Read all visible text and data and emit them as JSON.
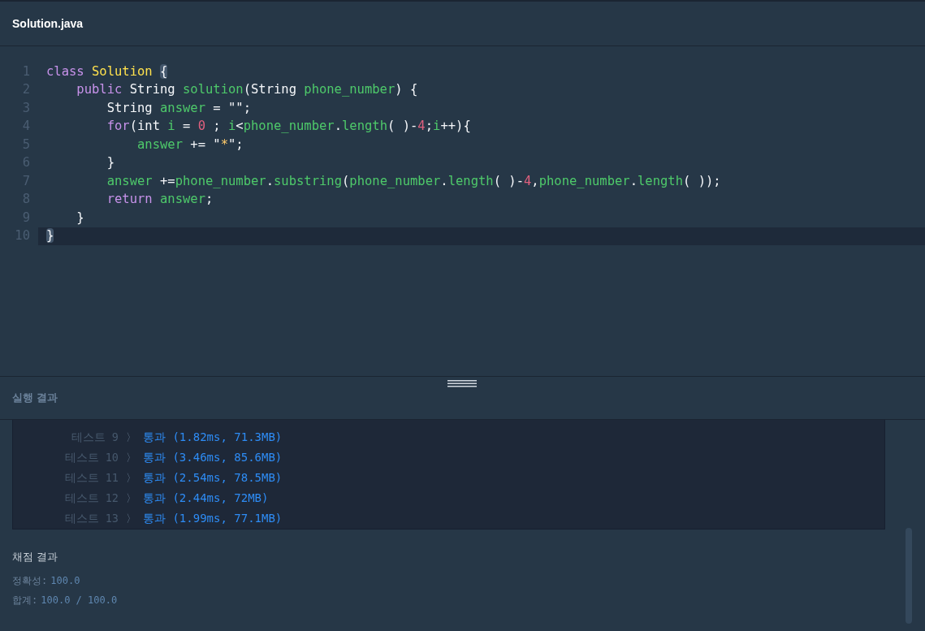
{
  "editor": {
    "file_name": "Solution.java",
    "lines": [
      {
        "number": "1",
        "current": false,
        "tokens": [
          {
            "text": "class ",
            "kind": "keyword"
          },
          {
            "text": "Solution ",
            "kind": "class"
          },
          {
            "text": "{",
            "kind": "bracket-match"
          }
        ]
      },
      {
        "number": "2",
        "current": false,
        "tokens": [
          {
            "text": "    public ",
            "kind": "keyword"
          },
          {
            "text": "String ",
            "kind": "plain"
          },
          {
            "text": "solution",
            "kind": "name"
          },
          {
            "text": "(String ",
            "kind": "plain"
          },
          {
            "text": "phone_number",
            "kind": "name"
          },
          {
            "text": ") {",
            "kind": "plain"
          }
        ]
      },
      {
        "number": "3",
        "current": false,
        "tokens": [
          {
            "text": "        String ",
            "kind": "plain"
          },
          {
            "text": "answer",
            "kind": "name"
          },
          {
            "text": " = \"\";",
            "kind": "plain"
          }
        ]
      },
      {
        "number": "4",
        "current": false,
        "tokens": [
          {
            "text": "        for",
            "kind": "keyword"
          },
          {
            "text": "(int ",
            "kind": "plain"
          },
          {
            "text": "i",
            "kind": "name"
          },
          {
            "text": " = ",
            "kind": "plain"
          },
          {
            "text": "0",
            "kind": "number"
          },
          {
            "text": " ; ",
            "kind": "plain"
          },
          {
            "text": "i",
            "kind": "name"
          },
          {
            "text": "<",
            "kind": "plain"
          },
          {
            "text": "phone_number",
            "kind": "name"
          },
          {
            "text": ".",
            "kind": "plain"
          },
          {
            "text": "length",
            "kind": "name"
          },
          {
            "text": "( )-",
            "kind": "plain"
          },
          {
            "text": "4",
            "kind": "number"
          },
          {
            "text": ";",
            "kind": "plain"
          },
          {
            "text": "i",
            "kind": "name"
          },
          {
            "text": "++){",
            "kind": "plain"
          }
        ]
      },
      {
        "number": "5",
        "current": false,
        "tokens": [
          {
            "text": "            answer",
            "kind": "name"
          },
          {
            "text": " += \"",
            "kind": "plain"
          },
          {
            "text": "*",
            "kind": "string"
          },
          {
            "text": "\";",
            "kind": "plain"
          }
        ]
      },
      {
        "number": "6",
        "current": false,
        "tokens": [
          {
            "text": "        }",
            "kind": "plain"
          }
        ]
      },
      {
        "number": "7",
        "current": false,
        "tokens": [
          {
            "text": "        answer",
            "kind": "name"
          },
          {
            "text": " +=",
            "kind": "plain"
          },
          {
            "text": "phone_number",
            "kind": "name"
          },
          {
            "text": ".",
            "kind": "plain"
          },
          {
            "text": "substring",
            "kind": "name"
          },
          {
            "text": "(",
            "kind": "plain"
          },
          {
            "text": "phone_number",
            "kind": "name"
          },
          {
            "text": ".",
            "kind": "plain"
          },
          {
            "text": "length",
            "kind": "name"
          },
          {
            "text": "( )-",
            "kind": "plain"
          },
          {
            "text": "4",
            "kind": "number"
          },
          {
            "text": ",",
            "kind": "plain"
          },
          {
            "text": "phone_number",
            "kind": "name"
          },
          {
            "text": ".",
            "kind": "plain"
          },
          {
            "text": "length",
            "kind": "name"
          },
          {
            "text": "( ));",
            "kind": "plain"
          }
        ]
      },
      {
        "number": "8",
        "current": false,
        "tokens": [
          {
            "text": "        return ",
            "kind": "keyword"
          },
          {
            "text": "answer",
            "kind": "name"
          },
          {
            "text": ";",
            "kind": "plain"
          }
        ]
      },
      {
        "number": "9",
        "current": false,
        "tokens": [
          {
            "text": "    }",
            "kind": "plain"
          }
        ]
      },
      {
        "number": "10",
        "current": true,
        "tokens": [
          {
            "text": "}",
            "kind": "bracket-match"
          }
        ]
      }
    ]
  },
  "results": {
    "title": "실행 결과",
    "tests": [
      {
        "label": "테스트 9",
        "arrow": "〉",
        "result": "통과 (1.82ms, 71.3MB)"
      },
      {
        "label": "테스트 10",
        "arrow": "〉",
        "result": "통과 (3.46ms, 85.6MB)"
      },
      {
        "label": "테스트 11",
        "arrow": "〉",
        "result": "통과 (2.54ms, 78.5MB)"
      },
      {
        "label": "테스트 12",
        "arrow": "〉",
        "result": "통과 (2.44ms, 72MB)"
      },
      {
        "label": "테스트 13",
        "arrow": "〉",
        "result": "통과 (1.99ms, 77.1MB)"
      }
    ],
    "grading": {
      "title": "채점 결과",
      "accuracy_label": "정확성:",
      "accuracy": "100.0",
      "total_label": "합계:",
      "total": "100.0 / 100.0"
    }
  }
}
